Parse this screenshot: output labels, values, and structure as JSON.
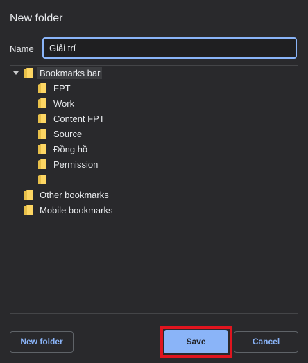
{
  "dialog": {
    "title": "New folder",
    "name_label": "Name",
    "name_value": "Giải trí"
  },
  "tree": {
    "root": {
      "label": "Bookmarks bar",
      "icon": "folder-icon",
      "expanded": true,
      "selected": true
    },
    "children": [
      {
        "label": "FPT",
        "icon": "folder-icon"
      },
      {
        "label": "Work",
        "icon": "folder-icon"
      },
      {
        "label": "Content FPT",
        "icon": "folder-icon"
      },
      {
        "label": "Source",
        "icon": "folder-icon"
      },
      {
        "label": "Đồng hồ",
        "icon": "folder-icon"
      },
      {
        "label": "Permission",
        "icon": "folder-icon"
      },
      {
        "label": "",
        "icon": "folder-icon"
      }
    ],
    "other": [
      {
        "label": "Other bookmarks",
        "icon": "folder-icon"
      },
      {
        "label": "Mobile bookmarks",
        "icon": "folder-icon"
      }
    ]
  },
  "buttons": {
    "new_folder": "New folder",
    "save": "Save",
    "cancel": "Cancel"
  },
  "colors": {
    "background": "#29292c",
    "accent": "#8ab4f8",
    "folder": "#fdd663",
    "highlight": "#e0151f"
  }
}
